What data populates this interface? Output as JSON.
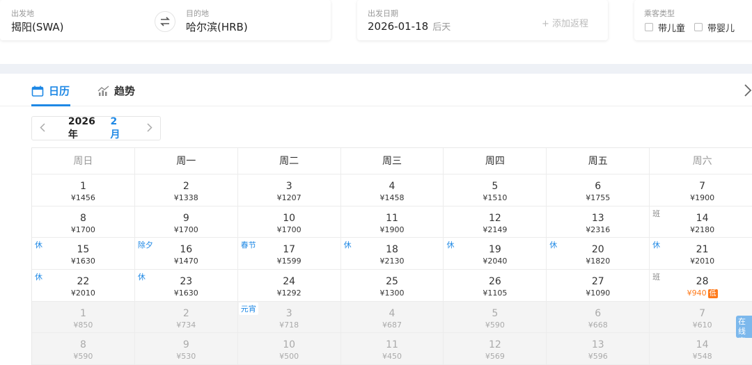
{
  "search": {
    "from_label": "出发地",
    "from_value": "揭阳(SWA)",
    "to_label": "目的地",
    "to_value": "哈尔滨(HRB)",
    "date_label": "出发日期",
    "date_value": "2026-01-18",
    "date_relative": "后天",
    "add_return": "+ 添加返程",
    "passenger_label": "乘客类型",
    "child_label": "带儿童",
    "infant_label": "带婴儿"
  },
  "tabs": [
    {
      "label": "日历",
      "icon": "calendar-icon",
      "active": true
    },
    {
      "label": "趋势",
      "icon": "trend-chart-icon",
      "active": false
    }
  ],
  "month_selector": {
    "year": "2026年",
    "month": "2月"
  },
  "calendar": {
    "weekdays": [
      "周日",
      "周一",
      "周二",
      "周三",
      "周四",
      "周五",
      "周六"
    ],
    "rows": [
      [
        {
          "day": "1",
          "price": "¥1456"
        },
        {
          "day": "2",
          "price": "¥1338"
        },
        {
          "day": "3",
          "price": "¥1207"
        },
        {
          "day": "4",
          "price": "¥1458"
        },
        {
          "day": "5",
          "price": "¥1510"
        },
        {
          "day": "6",
          "price": "¥1755"
        },
        {
          "day": "7",
          "price": "¥1900"
        }
      ],
      [
        {
          "day": "8",
          "price": "¥1700"
        },
        {
          "day": "9",
          "price": "¥1700"
        },
        {
          "day": "10",
          "price": "¥1700"
        },
        {
          "day": "11",
          "price": "¥1900"
        },
        {
          "day": "12",
          "price": "¥2149"
        },
        {
          "day": "13",
          "price": "¥2316"
        },
        {
          "day": "14",
          "price": "¥2180",
          "tag": "班",
          "tag_style": "gray"
        }
      ],
      [
        {
          "day": "15",
          "price": "¥1630",
          "tag": "休",
          "tag_style": "blue"
        },
        {
          "day": "16",
          "price": "¥1470",
          "tag": "除夕",
          "tag_style": "blue"
        },
        {
          "day": "17",
          "price": "¥1599",
          "tag": "春节",
          "tag_style": "blue"
        },
        {
          "day": "18",
          "price": "¥2130",
          "tag": "休",
          "tag_style": "blue"
        },
        {
          "day": "19",
          "price": "¥2040",
          "tag": "休",
          "tag_style": "blue"
        },
        {
          "day": "20",
          "price": "¥1820",
          "tag": "休",
          "tag_style": "blue"
        },
        {
          "day": "21",
          "price": "¥2010",
          "tag": "休",
          "tag_style": "blue"
        }
      ],
      [
        {
          "day": "22",
          "price": "¥2010",
          "tag": "休",
          "tag_style": "blue"
        },
        {
          "day": "23",
          "price": "¥1630",
          "tag": "休",
          "tag_style": "blue"
        },
        {
          "day": "24",
          "price": "¥1292"
        },
        {
          "day": "25",
          "price": "¥1300"
        },
        {
          "day": "26",
          "price": "¥1105"
        },
        {
          "day": "27",
          "price": "¥1090"
        },
        {
          "day": "28",
          "price": "¥940",
          "tag": "班",
          "tag_style": "gray",
          "low": true,
          "low_label": "低"
        }
      ],
      [
        {
          "day": "1",
          "price": "¥850",
          "gray": true
        },
        {
          "day": "2",
          "price": "¥734",
          "gray": true
        },
        {
          "day": "3",
          "price": "¥718",
          "gray": true,
          "tag": "元宵",
          "tag_style": "blue"
        },
        {
          "day": "4",
          "price": "¥687",
          "gray": true
        },
        {
          "day": "5",
          "price": "¥590",
          "gray": true
        },
        {
          "day": "6",
          "price": "¥668",
          "gray": true
        },
        {
          "day": "7",
          "price": "¥610",
          "gray": true
        }
      ],
      [
        {
          "day": "8",
          "price": "¥590",
          "gray": true
        },
        {
          "day": "9",
          "price": "¥530",
          "gray": true
        },
        {
          "day": "10",
          "price": "¥500",
          "gray": true
        },
        {
          "day": "11",
          "price": "¥450",
          "gray": true
        },
        {
          "day": "12",
          "price": "¥569",
          "gray": true
        },
        {
          "day": "13",
          "price": "¥596",
          "gray": true
        },
        {
          "day": "14",
          "price": "¥548",
          "gray": true
        }
      ]
    ]
  },
  "service": {
    "label": "在线客服"
  },
  "colors": {
    "accent": "#1e88e5",
    "low_price": "#ff7a1a"
  }
}
